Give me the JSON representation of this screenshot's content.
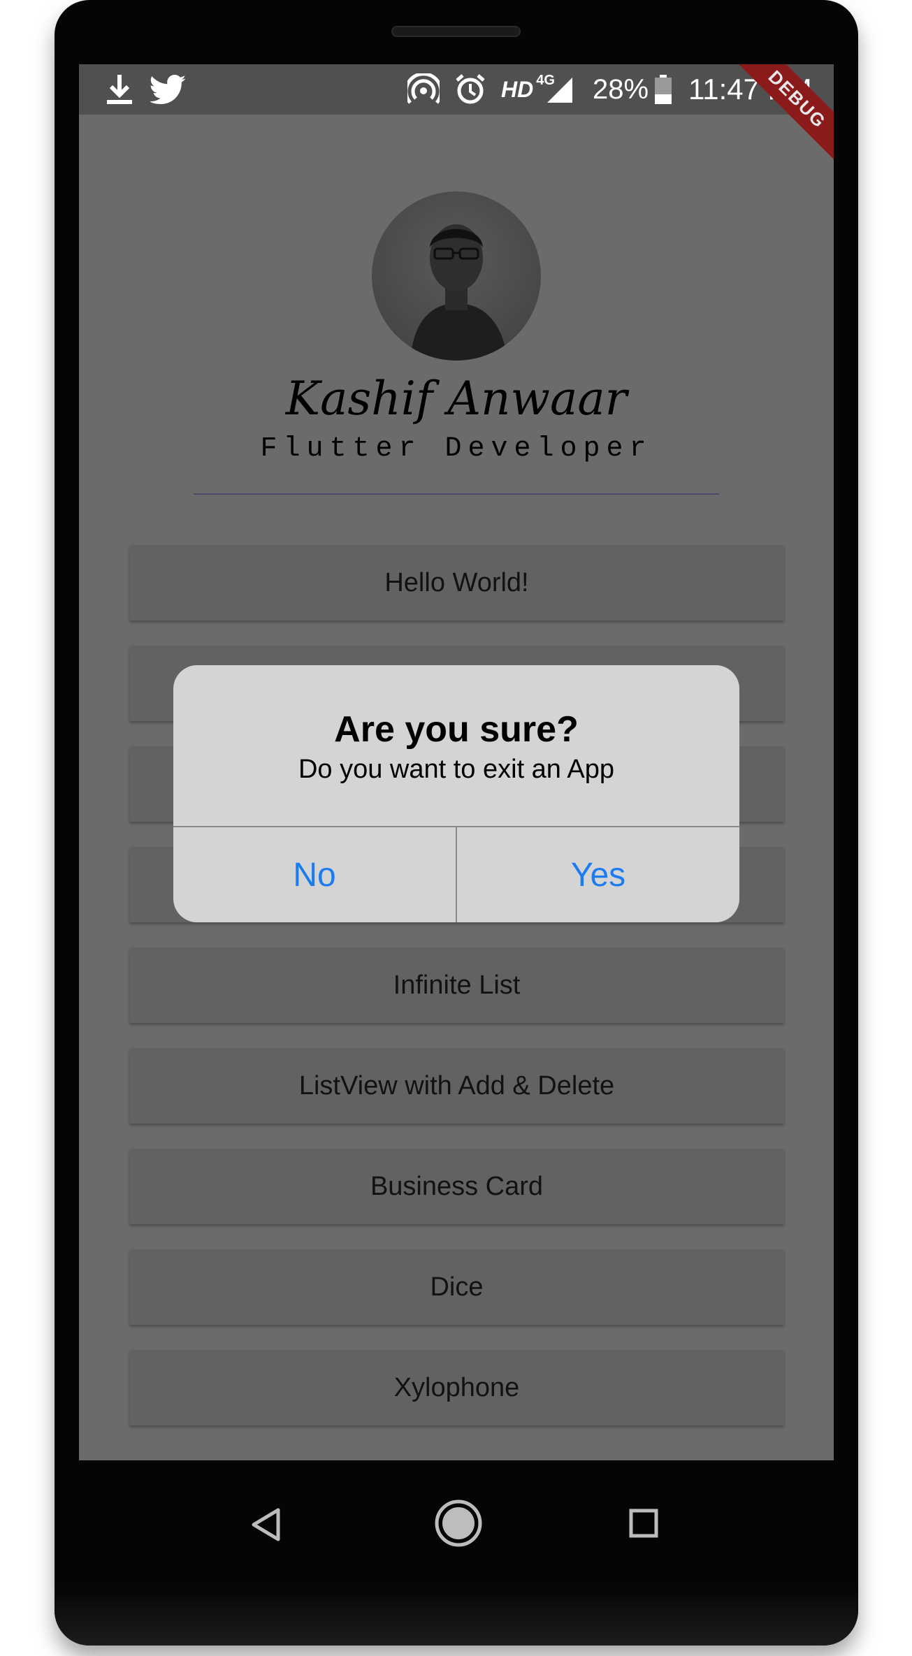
{
  "status_bar": {
    "network": "HD",
    "network_gen": "4G",
    "battery": "28%",
    "time": "11:47 PM",
    "icons": [
      "download-icon",
      "twitter-icon",
      "hotspot-icon",
      "alarm-icon",
      "signal-icon",
      "battery-icon"
    ]
  },
  "debug_banner": "DEBUG",
  "profile": {
    "name": "Kashif Anwaar",
    "role": "Flutter Developer"
  },
  "menu": {
    "items": [
      "Hello World!",
      "",
      "",
      "",
      "Infinite List",
      "ListView with Add & Delete",
      "Business Card",
      "Dice",
      "Xylophone"
    ]
  },
  "dialog": {
    "title": "Are you sure?",
    "message": "Do you want to exit an App",
    "no_label": "No",
    "yes_label": "Yes"
  },
  "colors": {
    "dialog_button_text": "#1a7cf0",
    "debug_banner": "#8b1a1a",
    "screen_dimmed": "#6b6b6b"
  },
  "nav_bar": {
    "icons": [
      "back-icon",
      "home-icon",
      "recents-icon"
    ]
  }
}
